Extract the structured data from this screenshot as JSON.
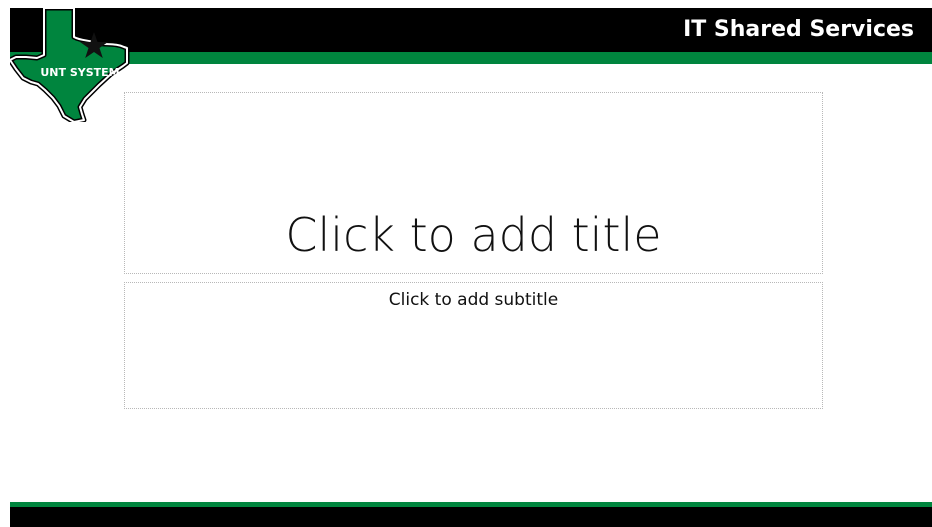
{
  "header": {
    "title": "IT Shared Services"
  },
  "logo": {
    "label": "UNT SYSTEM",
    "icon": "texas-star-logo"
  },
  "placeholders": {
    "title": "Click to add title",
    "subtitle": "Click to add subtitle"
  },
  "colors": {
    "brand_green": "#00853e",
    "bar_black": "#000000",
    "header_text": "#ffffff"
  }
}
